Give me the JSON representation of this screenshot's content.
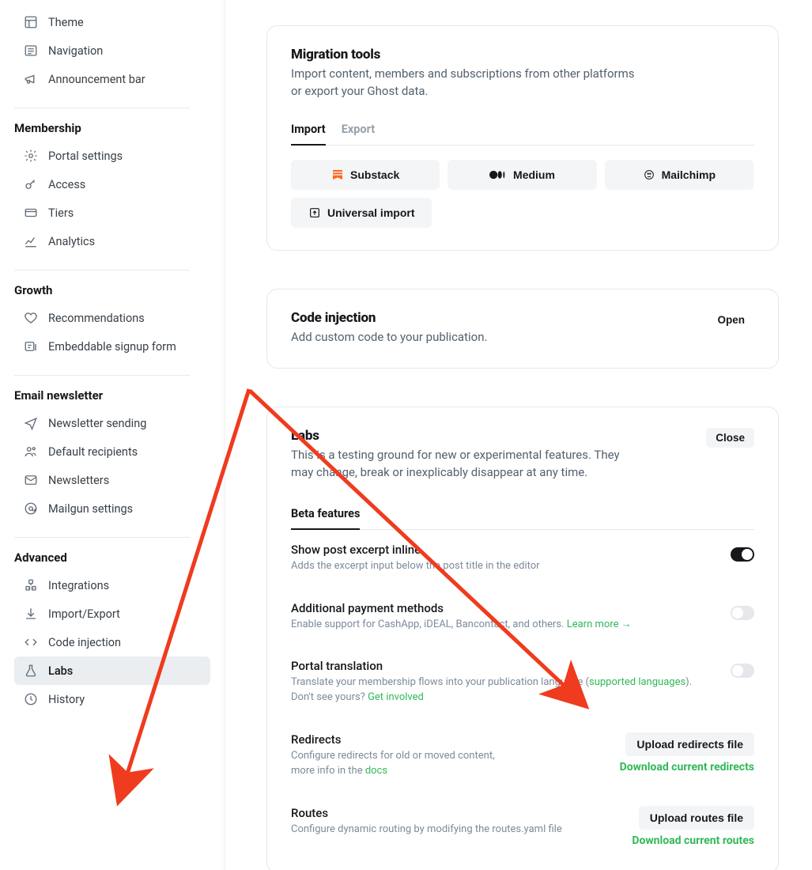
{
  "sidebar": {
    "items_top": [
      {
        "label": "Theme"
      },
      {
        "label": "Navigation"
      },
      {
        "label": "Announcement bar"
      }
    ],
    "groups": [
      {
        "heading": "Membership",
        "items": [
          {
            "label": "Portal settings"
          },
          {
            "label": "Access"
          },
          {
            "label": "Tiers"
          },
          {
            "label": "Analytics"
          }
        ]
      },
      {
        "heading": "Growth",
        "items": [
          {
            "label": "Recommendations"
          },
          {
            "label": "Embeddable signup form"
          }
        ]
      },
      {
        "heading": "Email newsletter",
        "items": [
          {
            "label": "Newsletter sending"
          },
          {
            "label": "Default recipients"
          },
          {
            "label": "Newsletters"
          },
          {
            "label": "Mailgun settings"
          }
        ]
      },
      {
        "heading": "Advanced",
        "items": [
          {
            "label": "Integrations"
          },
          {
            "label": "Import/Export"
          },
          {
            "label": "Code injection"
          },
          {
            "label": "Labs",
            "active": true
          },
          {
            "label": "History"
          }
        ]
      }
    ]
  },
  "migration": {
    "title": "Migration tools",
    "desc": "Import content, members and subscriptions from other platforms or export your Ghost data.",
    "tabs": [
      {
        "label": "Import",
        "active": true
      },
      {
        "label": "Export"
      }
    ],
    "buttons": [
      {
        "label": "Substack"
      },
      {
        "label": "Medium"
      },
      {
        "label": "Mailchimp"
      },
      {
        "label": "Universal import"
      }
    ]
  },
  "code_injection": {
    "title": "Code injection",
    "desc": "Add custom code to your publication.",
    "action": "Open"
  },
  "labs": {
    "title": "Labs",
    "desc": "This is a testing ground for new or experimental features. They may change, break or inexplicably disappear at any time.",
    "action": "Close",
    "tab": "Beta features",
    "features": [
      {
        "title": "Show post excerpt inline",
        "sub": "Adds the excerpt input below the post title in the editor",
        "on": true
      },
      {
        "title": "Additional payment methods",
        "sub": "Enable support for CashApp, iDEAL, Bancontact, and others. ",
        "link": "Learn more →",
        "on": false
      },
      {
        "title": "Portal translation",
        "sub_pre": "Translate your membership flows into your publication language (",
        "link1": "supported languages",
        "sub_mid": "). Don't see yours? ",
        "link2": "Get involved",
        "on": false
      }
    ],
    "redirects": {
      "title": "Redirects",
      "sub": "Configure redirects for old or moved content, more info in the ",
      "link": "docs",
      "upload": "Upload redirects file",
      "download": "Download current redirects"
    },
    "routes": {
      "title": "Routes",
      "sub": "Configure dynamic routing by modifying the routes.yaml file",
      "upload": "Upload routes file",
      "download": "Download current routes"
    }
  }
}
